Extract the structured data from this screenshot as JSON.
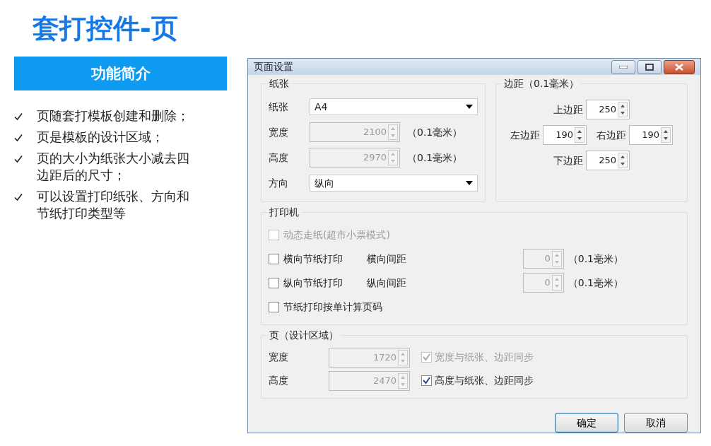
{
  "slide": {
    "title": "套打控件-页",
    "section_header": "功能简介",
    "bullets": [
      "页随套打模板创建和删除；",
      "页是模板的设计区域；",
      "页的大小为纸张大小减去四边距后的尺寸；",
      "可以设置打印纸张、方向和节纸打印类型等"
    ]
  },
  "dialog": {
    "title": "页面设置",
    "paper": {
      "title": "纸张",
      "rows": [
        {
          "kind": "select",
          "label": "纸张",
          "value": "A4"
        },
        {
          "kind": "spin",
          "label": "宽度",
          "value": "2100",
          "unit": "（0.1毫米）",
          "disabled": true
        },
        {
          "kind": "spin",
          "label": "高度",
          "value": "2970",
          "unit": "（0.1毫米）",
          "disabled": true
        },
        {
          "kind": "select",
          "label": "方向",
          "value": "纵向"
        }
      ]
    },
    "margins": {
      "title": "边距（0.1毫米）",
      "top": {
        "label": "上边距",
        "value": "250",
        "disabled": false
      },
      "left": {
        "label": "左边距",
        "value": "190",
        "disabled": false
      },
      "right": {
        "label": "右边距",
        "value": "190",
        "disabled": false
      },
      "bottom": {
        "label": "下边距",
        "value": "250",
        "disabled": false
      }
    },
    "printer": {
      "title": "打印机",
      "options": [
        {
          "label": "动态走纸(超市小票模式)",
          "checked": false,
          "disabled": true
        },
        {
          "label": "横向节纸打印",
          "checked": false,
          "disabled": false,
          "spacing_label": "横向间距",
          "spacing_value": "0",
          "spacing_unit": "（0.1毫米）",
          "spacing_disabled": true
        },
        {
          "label": "纵向节纸打印",
          "checked": false,
          "disabled": false,
          "spacing_label": "纵向间距",
          "spacing_value": "0",
          "spacing_unit": "（0.1毫米）",
          "spacing_disabled": true
        },
        {
          "label": "节纸打印按单计算页码",
          "checked": false,
          "disabled": false
        }
      ]
    },
    "page": {
      "title": "页（设计区域）",
      "rows": [
        {
          "label": "宽度",
          "value": "1720",
          "disabled": true,
          "sync_label": "宽度与纸张、边距同步",
          "checked": true,
          "sync_disabled": true
        },
        {
          "label": "高度",
          "value": "2470",
          "disabled": true,
          "sync_label": "高度与纸张、边距同步",
          "checked": true,
          "sync_disabled": false
        }
      ]
    },
    "buttons": [
      {
        "label": "确定",
        "default": true
      },
      {
        "label": "取消",
        "default": false
      }
    ]
  }
}
